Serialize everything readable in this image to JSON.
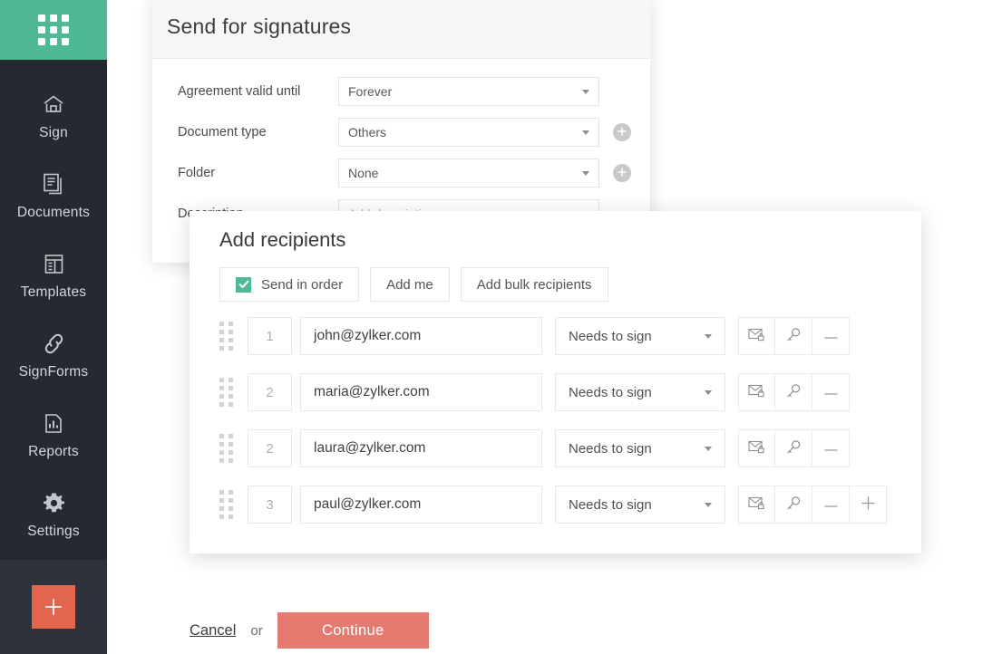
{
  "sidebar": {
    "logo_icon": "grid-apps-icon",
    "items": [
      {
        "label": "Sign",
        "icon": "home-icon"
      },
      {
        "label": "Documents",
        "icon": "documents-icon"
      },
      {
        "label": "Templates",
        "icon": "templates-icon"
      },
      {
        "label": "SignForms",
        "icon": "link-icon"
      },
      {
        "label": "Reports",
        "icon": "chart-document-icon"
      },
      {
        "label": "Settings",
        "icon": "gear-icon"
      }
    ],
    "add_button_icon": "plus-icon",
    "accent_color": "#4fb894",
    "add_button_color": "#e2664f",
    "background_color": "#252a31"
  },
  "send_card": {
    "title": "Send for signatures",
    "fields": [
      {
        "label": "Agreement valid until",
        "value": "Forever",
        "placeholder": "",
        "has_add": false
      },
      {
        "label": "Document type",
        "value": "Others",
        "placeholder": "",
        "has_add": true
      },
      {
        "label": "Folder",
        "value": "None",
        "placeholder": "",
        "has_add": true
      },
      {
        "label": "Description",
        "value": "",
        "placeholder": "Add description",
        "has_add": false
      }
    ]
  },
  "recipients": {
    "title": "Add recipients",
    "toolbar": {
      "send_in_order_label": "Send in order",
      "send_in_order_checked": true,
      "add_me_label": "Add me",
      "add_bulk_label": "Add bulk recipients"
    },
    "rows": [
      {
        "order": "1",
        "email": "john@zylker.com",
        "role": "Needs to sign",
        "has_add": false
      },
      {
        "order": "2",
        "email": "maria@zylker.com",
        "role": "Needs to sign",
        "has_add": false
      },
      {
        "order": "2",
        "email": "laura@zylker.com",
        "role": "Needs to sign",
        "has_add": false
      },
      {
        "order": "3",
        "email": "paul@zylker.com",
        "role": "Needs to sign",
        "has_add": true
      }
    ],
    "email_placeholder": "",
    "action_icons": {
      "private_message": "envelope-lock-icon",
      "access_code": "key-icon",
      "remove": "minus-icon",
      "add": "plus-icon"
    }
  },
  "footer": {
    "cancel_label": "Cancel",
    "or_label": "or",
    "continue_label": "Continue",
    "continue_color": "#e57b70"
  }
}
